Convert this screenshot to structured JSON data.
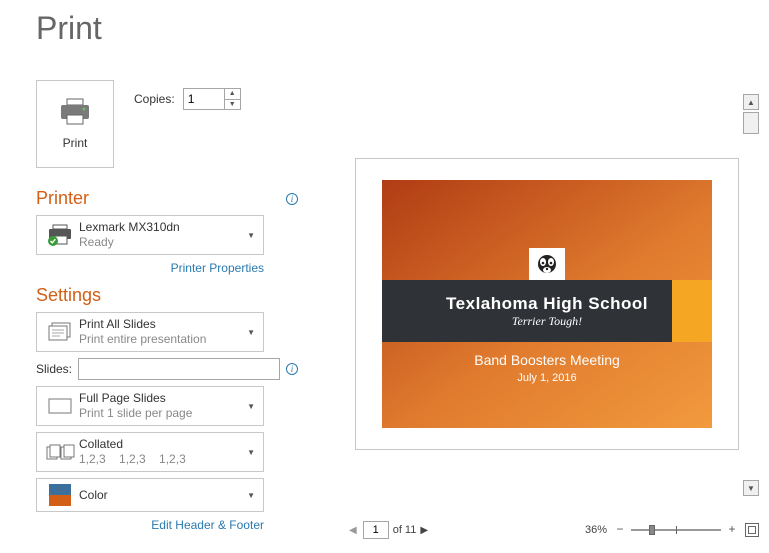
{
  "page_title": "Print",
  "print_button_label": "Print",
  "copies": {
    "label": "Copies:",
    "value": "1"
  },
  "sections": {
    "printer_header": "Printer",
    "settings_header": "Settings"
  },
  "printer": {
    "name": "Lexmark MX310dn",
    "status": "Ready",
    "properties_link": "Printer Properties"
  },
  "settings": {
    "what": {
      "title": "Print All Slides",
      "sub": "Print entire presentation"
    },
    "slides": {
      "label": "Slides:",
      "value": ""
    },
    "layout": {
      "title": "Full Page Slides",
      "sub": "Print 1 slide per page"
    },
    "collate": {
      "title": "Collated",
      "sub": "1,2,3    1,2,3    1,2,3"
    },
    "color": {
      "title": "Color"
    },
    "header_footer_link": "Edit Header & Footer"
  },
  "preview_slide": {
    "school": "Texlahoma High School",
    "tagline": "Terrier Tough!",
    "meeting": "Band Boosters Meeting",
    "date": "July 1, 2016"
  },
  "pager": {
    "current": "1",
    "of_label": "of 11"
  },
  "zoom": {
    "percent": "36%"
  }
}
